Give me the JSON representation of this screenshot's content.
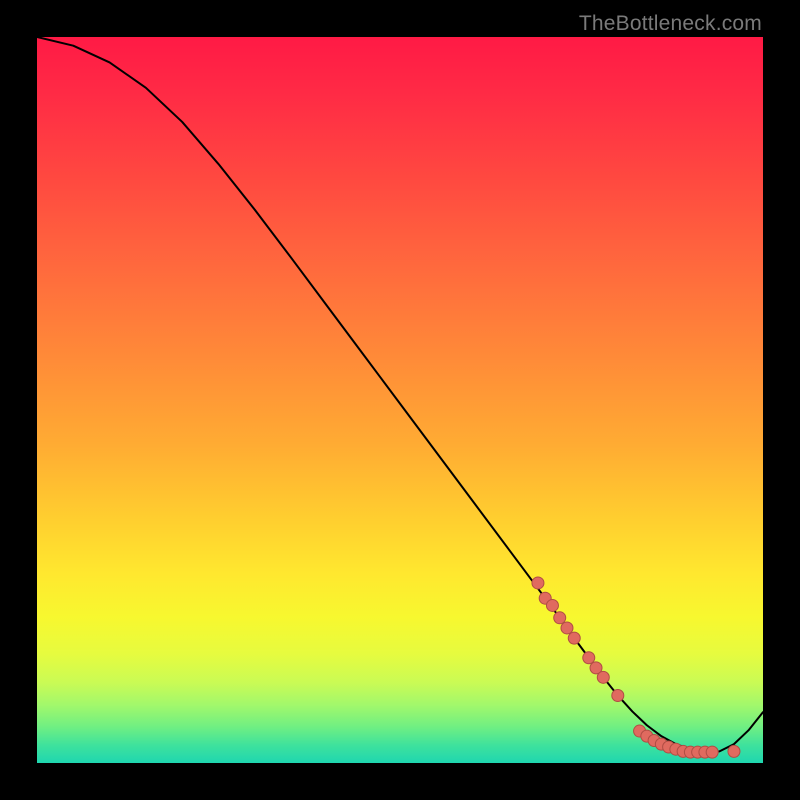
{
  "watermark": "TheBottleneck.com",
  "colors": {
    "dot_fill": "#e06a5f",
    "dot_stroke": "#b04d44",
    "curve": "#000000",
    "frame_bg": "#000000"
  },
  "chart_data": {
    "type": "line",
    "title": "",
    "xlabel": "",
    "ylabel": "",
    "xlim": [
      0,
      100
    ],
    "ylim": [
      0,
      100
    ],
    "grid": false,
    "legend": false,
    "x": [
      0,
      5,
      10,
      15,
      20,
      25,
      30,
      35,
      40,
      45,
      50,
      55,
      60,
      65,
      70,
      72,
      74,
      76,
      78,
      80,
      82,
      84,
      86,
      88,
      90,
      92,
      94,
      96,
      98,
      100
    ],
    "values": [
      100,
      98.8,
      96.5,
      93.0,
      88.3,
      82.5,
      76.2,
      69.6,
      62.9,
      56.2,
      49.5,
      42.8,
      36.1,
      29.4,
      22.7,
      20.0,
      17.2,
      14.5,
      11.8,
      9.3,
      7.1,
      5.2,
      3.7,
      2.6,
      1.9,
      1.5,
      1.6,
      2.6,
      4.5,
      7.0
    ],
    "dots_x": [
      69,
      70,
      71,
      72,
      73,
      74,
      76,
      77,
      78,
      80,
      83,
      84,
      85,
      86,
      87,
      88,
      89,
      90,
      91,
      92,
      93,
      96
    ],
    "dots_y": [
      24.8,
      22.7,
      21.7,
      20.0,
      18.6,
      17.2,
      14.5,
      13.1,
      11.8,
      9.3,
      4.4,
      3.7,
      3.1,
      2.6,
      2.2,
      1.9,
      1.6,
      1.5,
      1.5,
      1.5,
      1.5,
      1.6
    ]
  }
}
